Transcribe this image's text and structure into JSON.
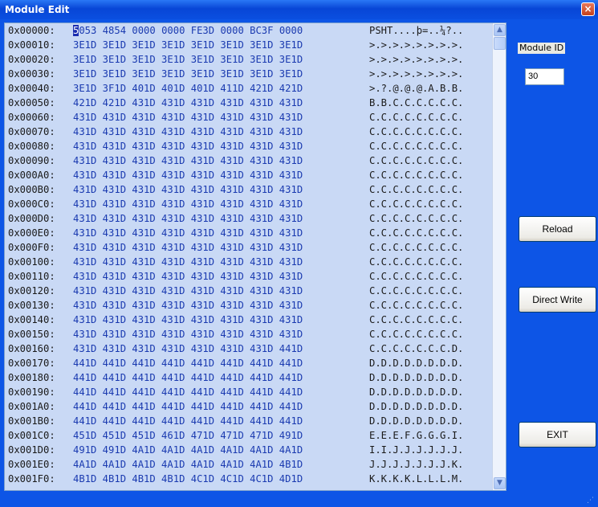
{
  "window": {
    "title": "Module Edit",
    "close_label": "×"
  },
  "module_id": {
    "label": "Module ID",
    "value": "30"
  },
  "buttons": {
    "reload": "Reload",
    "direct_write": "Direct Write",
    "exit": "EXIT"
  },
  "hex_rows": [
    {
      "addr": "0x00000:",
      "bytes": "5053 4854 0000 0000 FE3D 0000 BC3F 0000",
      "ascii": "PSHT....þ=..¼?.."
    },
    {
      "addr": "0x00010:",
      "bytes": "3E1D 3E1D 3E1D 3E1D 3E1D 3E1D 3E1D 3E1D",
      "ascii": ">.>.>.>.>.>.>.>."
    },
    {
      "addr": "0x00020:",
      "bytes": "3E1D 3E1D 3E1D 3E1D 3E1D 3E1D 3E1D 3E1D",
      "ascii": ">.>.>.>.>.>.>.>."
    },
    {
      "addr": "0x00030:",
      "bytes": "3E1D 3E1D 3E1D 3E1D 3E1D 3E1D 3E1D 3E1D",
      "ascii": ">.>.>.>.>.>.>.>."
    },
    {
      "addr": "0x00040:",
      "bytes": "3E1D 3F1D 401D 401D 401D 411D 421D 421D",
      "ascii": ">.?.@.@.@.A.B.B."
    },
    {
      "addr": "0x00050:",
      "bytes": "421D 421D 431D 431D 431D 431D 431D 431D",
      "ascii": "B.B.C.C.C.C.C.C."
    },
    {
      "addr": "0x00060:",
      "bytes": "431D 431D 431D 431D 431D 431D 431D 431D",
      "ascii": "C.C.C.C.C.C.C.C."
    },
    {
      "addr": "0x00070:",
      "bytes": "431D 431D 431D 431D 431D 431D 431D 431D",
      "ascii": "C.C.C.C.C.C.C.C."
    },
    {
      "addr": "0x00080:",
      "bytes": "431D 431D 431D 431D 431D 431D 431D 431D",
      "ascii": "C.C.C.C.C.C.C.C."
    },
    {
      "addr": "0x00090:",
      "bytes": "431D 431D 431D 431D 431D 431D 431D 431D",
      "ascii": "C.C.C.C.C.C.C.C."
    },
    {
      "addr": "0x000A0:",
      "bytes": "431D 431D 431D 431D 431D 431D 431D 431D",
      "ascii": "C.C.C.C.C.C.C.C."
    },
    {
      "addr": "0x000B0:",
      "bytes": "431D 431D 431D 431D 431D 431D 431D 431D",
      "ascii": "C.C.C.C.C.C.C.C."
    },
    {
      "addr": "0x000C0:",
      "bytes": "431D 431D 431D 431D 431D 431D 431D 431D",
      "ascii": "C.C.C.C.C.C.C.C."
    },
    {
      "addr": "0x000D0:",
      "bytes": "431D 431D 431D 431D 431D 431D 431D 431D",
      "ascii": "C.C.C.C.C.C.C.C."
    },
    {
      "addr": "0x000E0:",
      "bytes": "431D 431D 431D 431D 431D 431D 431D 431D",
      "ascii": "C.C.C.C.C.C.C.C."
    },
    {
      "addr": "0x000F0:",
      "bytes": "431D 431D 431D 431D 431D 431D 431D 431D",
      "ascii": "C.C.C.C.C.C.C.C."
    },
    {
      "addr": "0x00100:",
      "bytes": "431D 431D 431D 431D 431D 431D 431D 431D",
      "ascii": "C.C.C.C.C.C.C.C."
    },
    {
      "addr": "0x00110:",
      "bytes": "431D 431D 431D 431D 431D 431D 431D 431D",
      "ascii": "C.C.C.C.C.C.C.C."
    },
    {
      "addr": "0x00120:",
      "bytes": "431D 431D 431D 431D 431D 431D 431D 431D",
      "ascii": "C.C.C.C.C.C.C.C."
    },
    {
      "addr": "0x00130:",
      "bytes": "431D 431D 431D 431D 431D 431D 431D 431D",
      "ascii": "C.C.C.C.C.C.C.C."
    },
    {
      "addr": "0x00140:",
      "bytes": "431D 431D 431D 431D 431D 431D 431D 431D",
      "ascii": "C.C.C.C.C.C.C.C."
    },
    {
      "addr": "0x00150:",
      "bytes": "431D 431D 431D 431D 431D 431D 431D 431D",
      "ascii": "C.C.C.C.C.C.C.C."
    },
    {
      "addr": "0x00160:",
      "bytes": "431D 431D 431D 431D 431D 431D 431D 441D",
      "ascii": "C.C.C.C.C.C.C.D."
    },
    {
      "addr": "0x00170:",
      "bytes": "441D 441D 441D 441D 441D 441D 441D 441D",
      "ascii": "D.D.D.D.D.D.D.D."
    },
    {
      "addr": "0x00180:",
      "bytes": "441D 441D 441D 441D 441D 441D 441D 441D",
      "ascii": "D.D.D.D.D.D.D.D."
    },
    {
      "addr": "0x00190:",
      "bytes": "441D 441D 441D 441D 441D 441D 441D 441D",
      "ascii": "D.D.D.D.D.D.D.D."
    },
    {
      "addr": "0x001A0:",
      "bytes": "441D 441D 441D 441D 441D 441D 441D 441D",
      "ascii": "D.D.D.D.D.D.D.D."
    },
    {
      "addr": "0x001B0:",
      "bytes": "441D 441D 441D 441D 441D 441D 441D 441D",
      "ascii": "D.D.D.D.D.D.D.D."
    },
    {
      "addr": "0x001C0:",
      "bytes": "451D 451D 451D 461D 471D 471D 471D 491D",
      "ascii": "E.E.E.F.G.G.G.I."
    },
    {
      "addr": "0x001D0:",
      "bytes": "491D 491D 4A1D 4A1D 4A1D 4A1D 4A1D 4A1D",
      "ascii": "I.I.J.J.J.J.J.J."
    },
    {
      "addr": "0x001E0:",
      "bytes": "4A1D 4A1D 4A1D 4A1D 4A1D 4A1D 4A1D 4B1D",
      "ascii": "J.J.J.J.J.J.J.K."
    },
    {
      "addr": "0x001F0:",
      "bytes": "4B1D 4B1D 4B1D 4B1D 4C1D 4C1D 4C1D 4D1D",
      "ascii": "K.K.K.K.L.L.L.M."
    }
  ],
  "colors": {
    "window_bg": "#0d55e6",
    "hex_bg": "#c9d9f5",
    "byte_text": "#1a3ab0"
  },
  "icons": {
    "scroll_up": "▲",
    "scroll_down": "▼",
    "resize_grip": "⋰"
  }
}
